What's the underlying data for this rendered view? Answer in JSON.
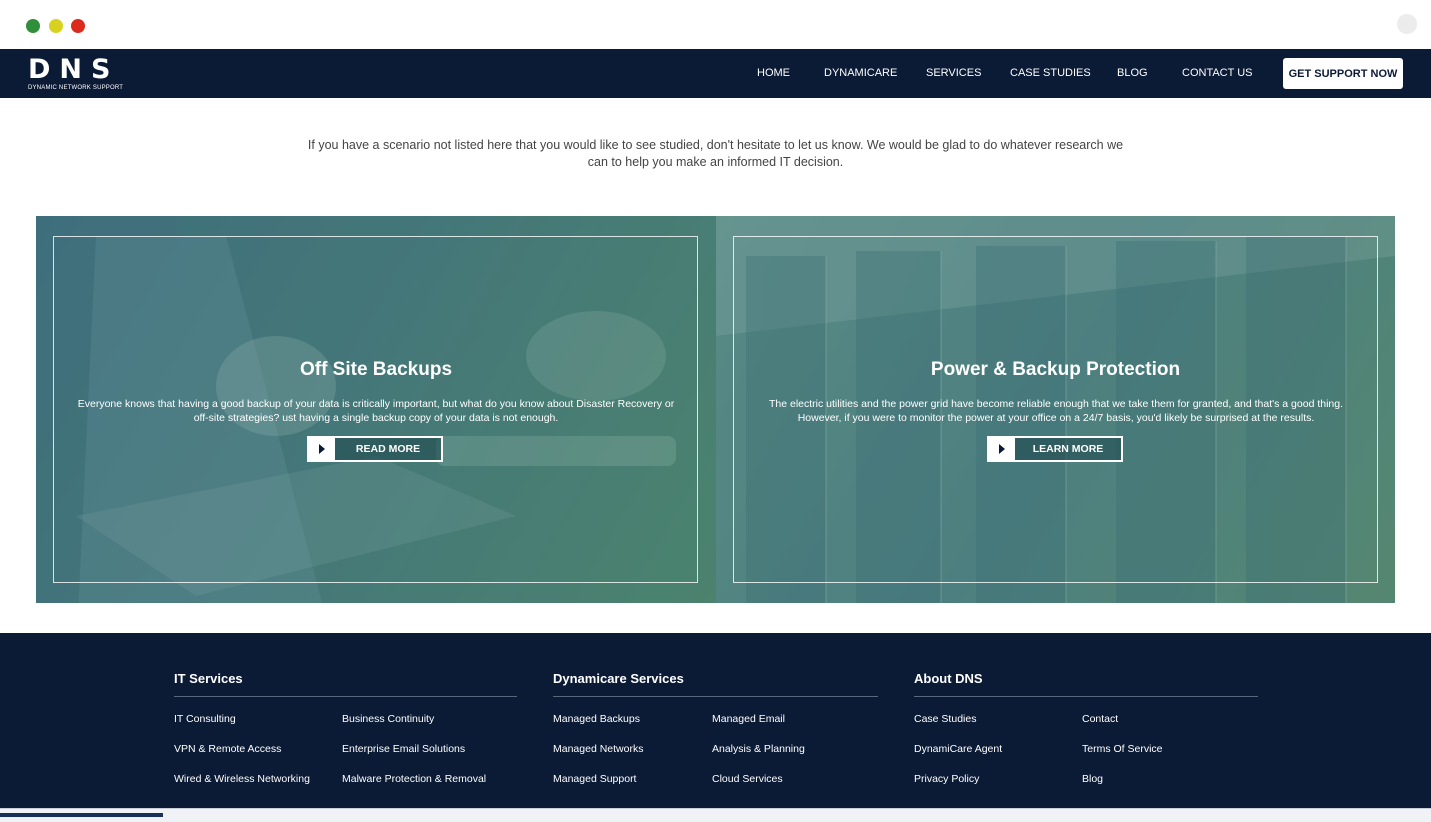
{
  "window": {
    "controls": [
      "close",
      "minimize",
      "maximize"
    ]
  },
  "header": {
    "logo_mark": "DNS",
    "logo_tagline": "DYNAMIC NETWORK SUPPORT",
    "nav": [
      "HOME",
      "DYNAMICARE",
      "SERVICES",
      "CASE STUDIES",
      "BLOG",
      "CONTACT US"
    ],
    "cta_label": "GET SUPPORT NOW"
  },
  "intro": {
    "text": "If you have a scenario not listed here that you would like to see studied, don't hesitate to let us know. We would be glad to do whatever research we can to help you make an informed IT decision."
  },
  "cards": [
    {
      "title": "Off Site Backups",
      "description": "Everyone knows that having a good backup of your data is critically important, but what do you know about Disaster Recovery or off-site strategies? ust having a single backup copy of your data is not enough.",
      "button_label": "READ MORE"
    },
    {
      "title": "Power & Backup Protection",
      "description": "The electric utilities and the power grid have become reliable enough that we take them for granted, and that's a good thing. However, if you were to monitor the power at your office on a 24/7 basis, you'd likely be surprised at the results.",
      "button_label": "LEARN MORE"
    }
  ],
  "footer": {
    "columns": [
      {
        "title": "IT Services",
        "links": [
          "IT Consulting",
          "Business Continuity",
          "VPN & Remote Access",
          "Enterprise Email Solutions",
          "Wired & Wireless Networking",
          "Malware Protection & Removal"
        ]
      },
      {
        "title": "Dynamicare Services",
        "links": [
          "Managed Backups",
          "Managed Email",
          "Managed Networks",
          "Analysis & Planning",
          "Managed Support",
          "Cloud Services"
        ]
      },
      {
        "title": "About DNS",
        "links": [
          "Case Studies",
          "Contact",
          "DynamiCare Agent",
          "Terms Of Service",
          "Privacy Policy",
          "Blog"
        ]
      }
    ]
  },
  "colors": {
    "navy": "#0b1a35",
    "card_teal": "#467a78",
    "card_green": "#4f8a6a",
    "dot_green": "#2f8f3a",
    "dot_yellow": "#d8d21f",
    "dot_red": "#dc2a1c"
  }
}
